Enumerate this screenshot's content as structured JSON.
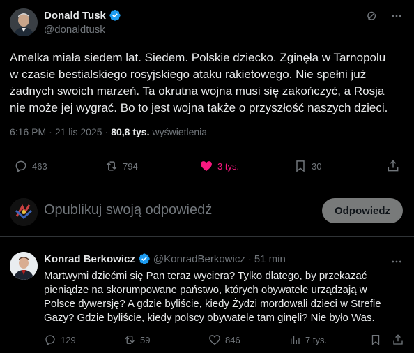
{
  "post": {
    "author": {
      "name": "Donald Tusk",
      "handle": "@donaldtusk"
    },
    "text": "Amelka miała siedem lat. Siedem. Polskie dziecko. Zginęła w Tarnopolu\nw czasie bestialskiego rosyjskiego ataku rakietowego. Nie spełni już\nżadnych swoich marzeń. Ta okrutna wojna musi się zakończyć, a Rosja\nnie może jej wygrać. Bo to jest wojna także o przyszłość naszych dzieci.",
    "time": "6:16 PM",
    "separator": "·",
    "date": "21 lis 2025",
    "views_count": "80,8 tys.",
    "views_label": "wyświetlenia",
    "stats": {
      "replies": "463",
      "reposts": "794",
      "likes": "3 tys.",
      "bookmarks": "30"
    },
    "icons": [
      "grok-icon",
      "more-icon",
      "reply-icon",
      "repost-icon",
      "like-icon",
      "bookmark-icon",
      "share-icon"
    ],
    "like_color": "#f91880"
  },
  "reply_box": {
    "placeholder": "Opublikuj swoją odpowiedź",
    "button_label": "Odpowiedz"
  },
  "comment": {
    "author": {
      "name": "Konrad Berkowicz",
      "handle": "@KonradBerkowicz"
    },
    "separator": "·",
    "time": "51 min",
    "text": "Martwymi dziećmi się Pan teraz wyciera? Tylko dlatego, by przekazać\npieniądze na skorumpowane państwo, których obywatele urządzają w\nPolsce dywersję? A gdzie byliście, kiedy Żydzi mordowali dzieci w Strefie\nGazy? Gdzie byliście, kiedy polscy obywatele tam ginęli? Nie było Was.",
    "stats": {
      "replies": "129",
      "reposts": "59",
      "likes": "846",
      "views": "7 tys."
    }
  },
  "colors": {
    "background": "#000000",
    "text": "#e7e9ea",
    "muted": "#71767b",
    "verified": "#1d9bf0",
    "divider": "#2f3336"
  }
}
